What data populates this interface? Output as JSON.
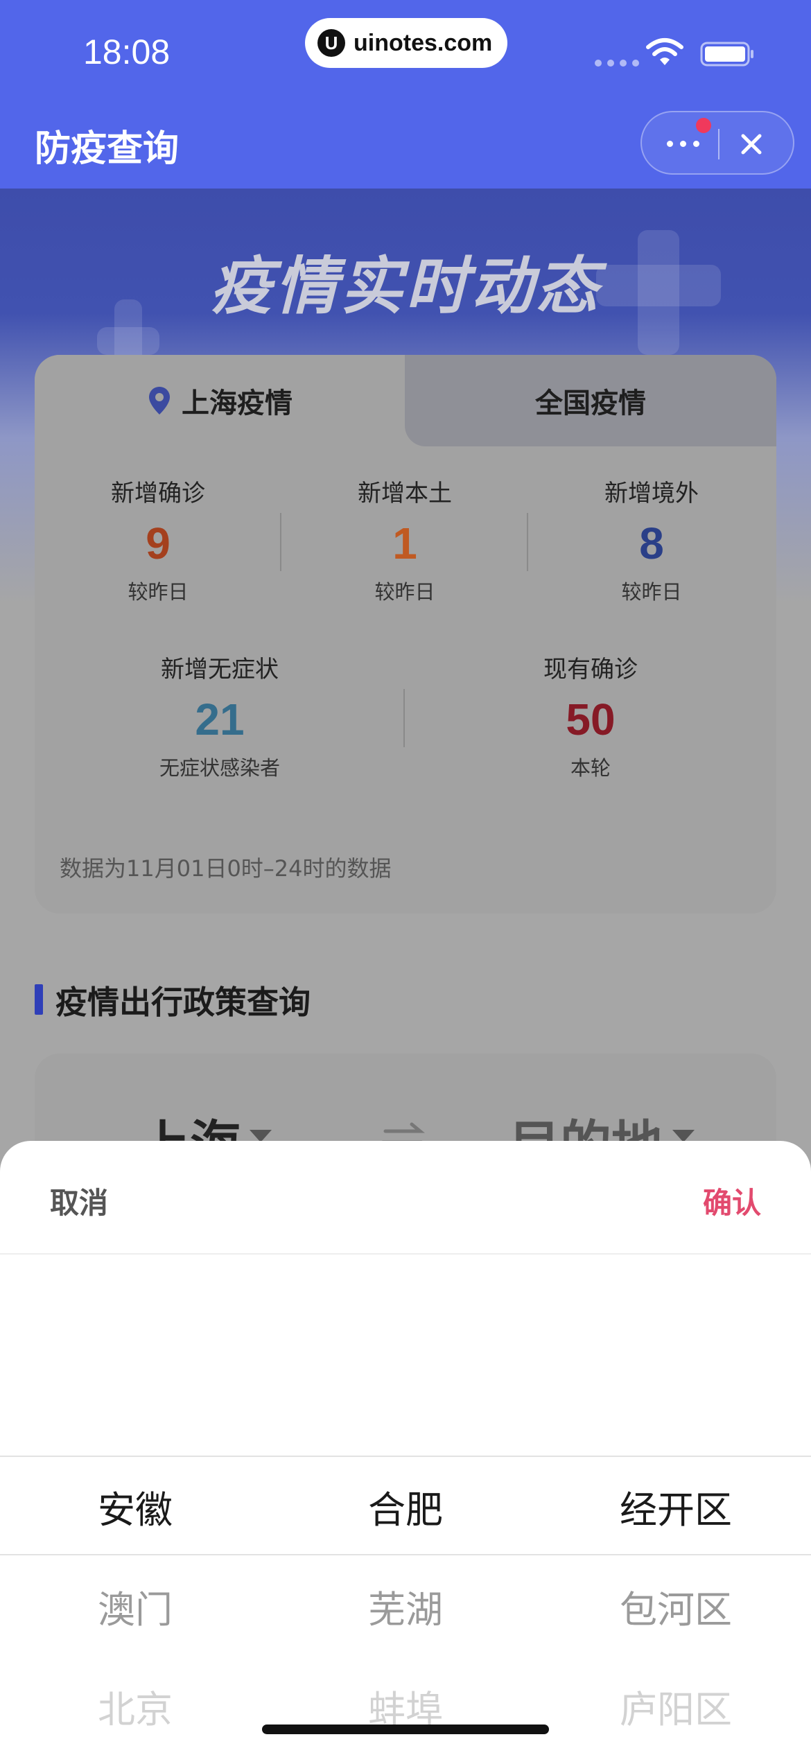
{
  "status_bar": {
    "time": "18:08",
    "url": "uinotes.com"
  },
  "nav": {
    "title": "防疫查询"
  },
  "hero": {
    "title": "疫情实时动态"
  },
  "stats": {
    "tabs": [
      {
        "label": "上海疫情",
        "active": true
      },
      {
        "label": "全国疫情",
        "active": false
      }
    ],
    "row1": [
      {
        "label": "新增确诊",
        "value": "9",
        "sub": "较昨日",
        "color": "#a4401e"
      },
      {
        "label": "新增本土",
        "value": "1",
        "sub": "较昨日",
        "color": "#c05a22"
      },
      {
        "label": "新增境外",
        "value": "8",
        "sub": "较昨日",
        "color": "#2a3f88"
      }
    ],
    "row2": [
      {
        "label": "新增无症状",
        "value": "21",
        "sub": "无症状感染者",
        "color": "#356d8c"
      },
      {
        "label": "现有确诊",
        "value": "50",
        "sub": "本轮",
        "color": "#861a26"
      }
    ],
    "note": "数据为11月01日0时–24时的数据"
  },
  "policy": {
    "section_title": "疫情出行政策查询",
    "from": "上海",
    "to": "目的地"
  },
  "picker": {
    "cancel_label": "取消",
    "confirm_label": "确认",
    "columns": [
      {
        "selected": "安徽",
        "next1": "澳门",
        "next2": "北京"
      },
      {
        "selected": "合肥",
        "next1": "芜湖",
        "next2": "蚌埠"
      },
      {
        "selected": "经开区",
        "next1": "包河区",
        "next2": "庐阳区"
      }
    ]
  }
}
